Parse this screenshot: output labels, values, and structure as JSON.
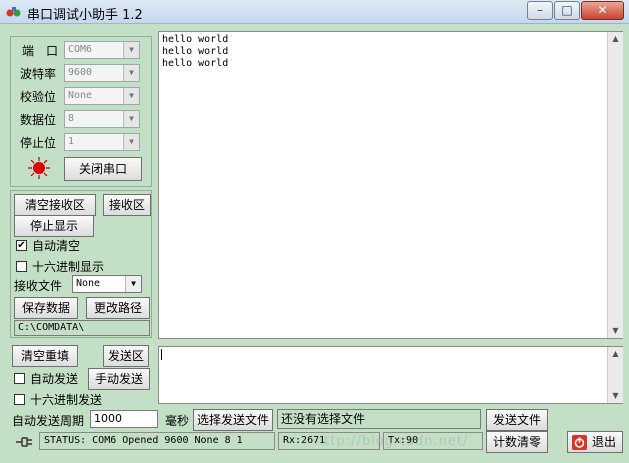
{
  "window": {
    "title": "串口调试小助手 1.2",
    "minimize_glyph": "–",
    "maximize_glyph": "□",
    "close_glyph": "✕"
  },
  "settings": {
    "port_label": "端　口",
    "port_value": "COM6",
    "baud_label": "波特率",
    "baud_value": "9600",
    "parity_label": "校验位",
    "parity_value": "None",
    "databits_label": "数据位",
    "databits_value": "8",
    "stopbits_label": "停止位",
    "stopbits_value": "1",
    "close_port_label": "关闭串口",
    "indicator_color": "#e00000"
  },
  "receive": {
    "clear_label": "清空接收区",
    "area_label": "接收区",
    "stop_display_label": "停止显示",
    "auto_clear_label": "自动清空",
    "auto_clear_checked": true,
    "auto_clear_check": "✔",
    "hex_display_label": "十六进制显示",
    "hex_display_checked": false,
    "file_label": "接收文件",
    "file_value": "None",
    "save_label": "保存数据",
    "change_path_label": "更改路径",
    "path": "C:\\COMDATA\\",
    "content": "hello world\nhello world\nhello world"
  },
  "send": {
    "clear_label": "清空重填",
    "area_label": "发送区",
    "auto_send_label": "自动发送",
    "manual_send_label": "手动发送",
    "hex_send_label": "十六进制发送",
    "period_label": "自动发送周期",
    "period_value": "1000",
    "ms_label": "毫秒",
    "choose_file_label": "选择发送文件",
    "file_status": "还没有选择文件",
    "send_file_label": "发送文件",
    "content": ""
  },
  "statusbar": {
    "status": "STATUS: COM6 Opened 9600 None 8 1",
    "rx": "Rx:2671",
    "tx": "Tx:90",
    "reset_count_label": "计数清零",
    "exit_label": "退出",
    "watermark": "http://blog.csdn.net/"
  }
}
